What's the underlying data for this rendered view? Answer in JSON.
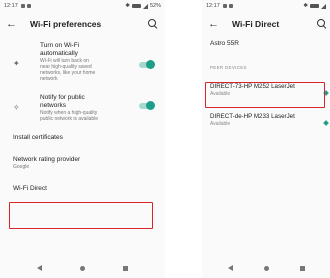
{
  "left_screen": {
    "status_bar": {
      "time": "12:17",
      "battery": "52%"
    },
    "app_bar": {
      "back_glyph": "←",
      "title": "Wi-Fi preferences"
    },
    "items": [
      {
        "title_lines": [
          "Turn on Wi-Fi",
          "automatically"
        ],
        "subtitle_lines": [
          "Wi-Fi will turn back on",
          "near high-quality saved",
          "networks, like your home",
          "network"
        ],
        "icon": "wifi-auto-icon",
        "toggle_on": true
      },
      {
        "title_lines": [
          "Notify for public",
          "networks"
        ],
        "subtitle_lines": [
          "Notify when a high-quality",
          "public network is available"
        ],
        "icon": "wifi-notify-icon",
        "toggle_on": true
      }
    ],
    "install_certificates": "Install certificates",
    "network_rating": {
      "title": "Network rating provider",
      "subtitle": "Google"
    },
    "wifi_direct": "Wi-Fi Direct"
  },
  "right_screen": {
    "status_bar": {
      "time": "12:17"
    },
    "app_bar": {
      "back_glyph": "←",
      "title": "Wi-Fi Direct"
    },
    "this_device": "Astro 55R",
    "peer_devices_label": "PEER DEVICES",
    "devices": [
      {
        "name": "DIRECT-73-HP M252 LaserJet",
        "status": "Available"
      },
      {
        "name": "DIRECT-de-HP M233 LaserJet",
        "status": "Available"
      }
    ]
  },
  "colors": {
    "accent": "#1e9e88",
    "highlight": "#d8262d"
  }
}
